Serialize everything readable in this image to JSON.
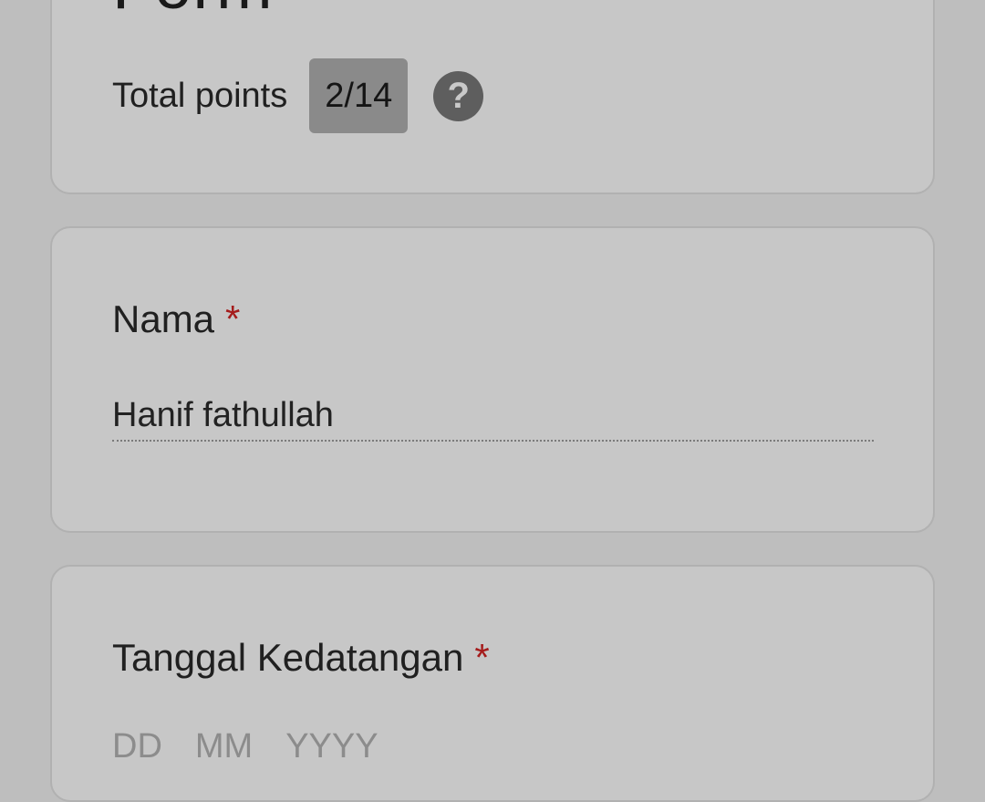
{
  "header": {
    "title": "Form",
    "total_points_label": "Total points",
    "score": "2/14",
    "help_glyph": "?"
  },
  "questions": [
    {
      "label": "Nama",
      "required_mark": "*",
      "answer": "Hanif fathullah"
    },
    {
      "label": "Tanggal Kedatangan",
      "required_mark": "*",
      "date_parts": [
        "DD",
        "MM",
        "YYYY"
      ]
    }
  ],
  "colors": {
    "background": "#bebebe",
    "card": "#c7c7c7",
    "required": "#a51c1c",
    "score_badge": "#8a8a8a",
    "help_icon": "#5e5e5e"
  },
  "icons": {
    "help": "help-circle-icon"
  }
}
